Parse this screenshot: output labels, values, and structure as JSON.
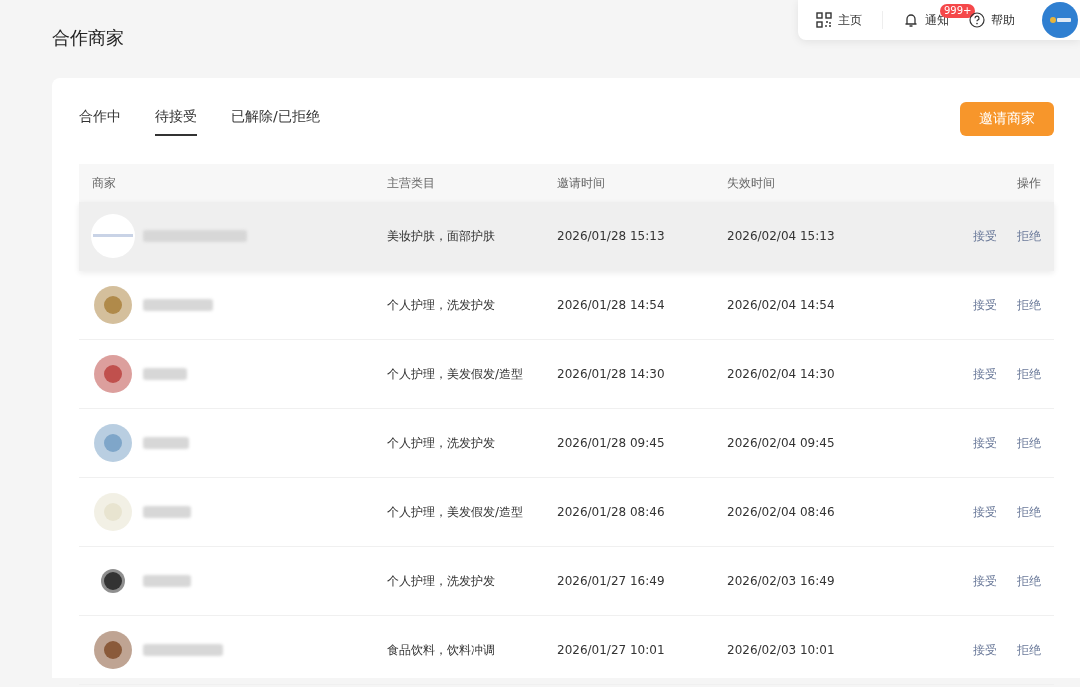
{
  "top_bar": {
    "home": "主页",
    "notifications": "通知",
    "notification_badge": "999+",
    "help": "帮助"
  },
  "page_title": "合作商家",
  "tabs": [
    {
      "label": "合作中",
      "selected": false
    },
    {
      "label": "待接受",
      "selected": true
    },
    {
      "label": "已解除/已拒绝",
      "selected": false
    }
  ],
  "invite_button": "邀请商家",
  "table": {
    "columns": [
      "商家",
      "主营类目",
      "邀请时间",
      "失效时间",
      "操作"
    ],
    "rows": [
      {
        "highlighted": true,
        "category": "美妆护肤，面部护肤",
        "invited": "2026/01/28 15:13",
        "expires": "2026/02/04 15:13",
        "actions": [
          "接受",
          "拒绝"
        ]
      },
      {
        "highlighted": false,
        "category": "个人护理，洗发护发",
        "invited": "2026/01/28 14:54",
        "expires": "2026/02/04 14:54",
        "actions": [
          "接受",
          "拒绝"
        ]
      },
      {
        "highlighted": false,
        "category": "个人护理，美发假发/造型",
        "invited": "2026/01/28 14:30",
        "expires": "2026/02/04 14:30",
        "actions": [
          "接受",
          "拒绝"
        ]
      },
      {
        "highlighted": false,
        "category": "个人护理，洗发护发",
        "invited": "2026/01/28 09:45",
        "expires": "2026/02/04 09:45",
        "actions": [
          "接受",
          "拒绝"
        ]
      },
      {
        "highlighted": false,
        "category": "个人护理，美发假发/造型",
        "invited": "2026/01/28 08:46",
        "expires": "2026/02/04 08:46",
        "actions": [
          "接受",
          "拒绝"
        ]
      },
      {
        "highlighted": false,
        "category": "个人护理，洗发护发",
        "invited": "2026/01/27 16:49",
        "expires": "2026/02/03 16:49",
        "actions": [
          "接受",
          "拒绝"
        ]
      },
      {
        "highlighted": false,
        "category": "食品饮料，饮料冲调",
        "invited": "2026/01/27 10:01",
        "expires": "2026/02/03 10:01",
        "actions": [
          "接受",
          "拒绝"
        ]
      }
    ]
  }
}
